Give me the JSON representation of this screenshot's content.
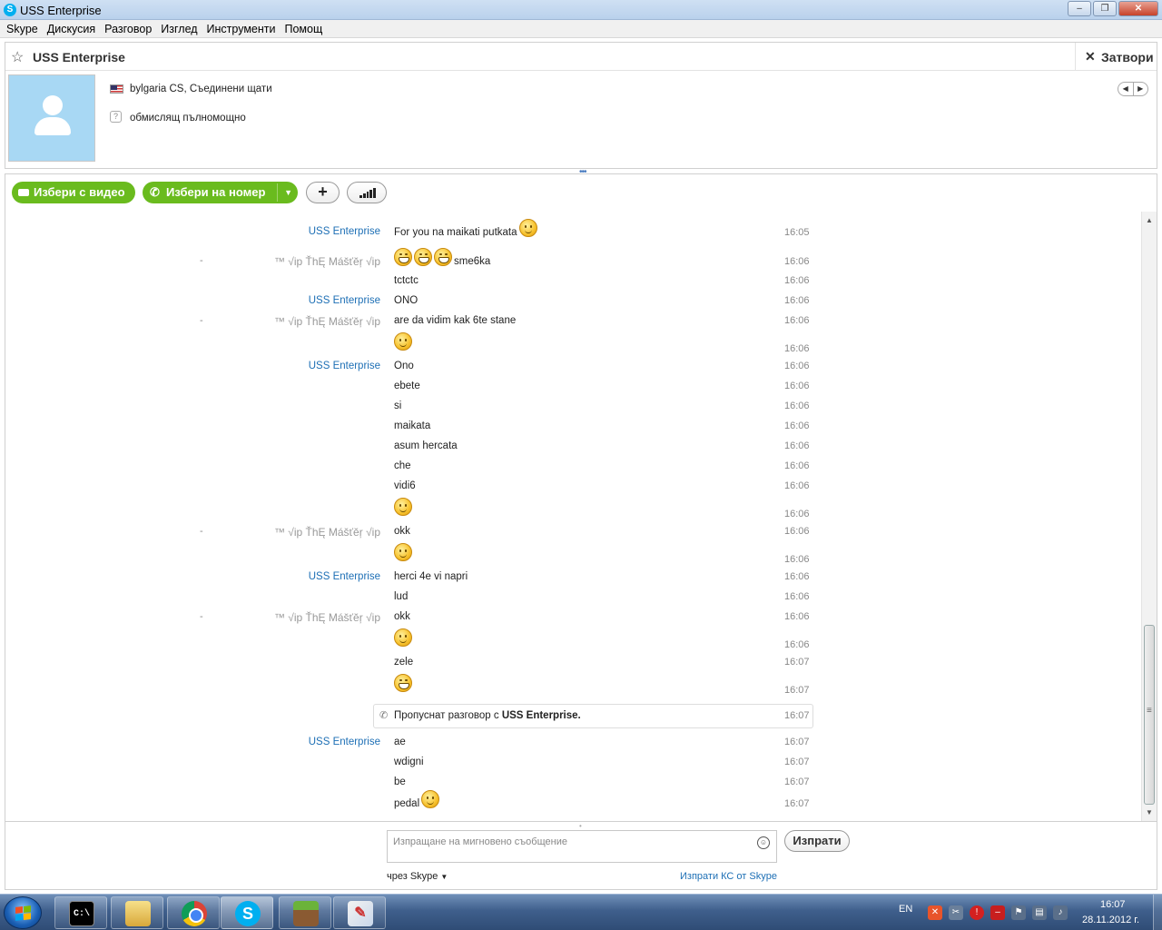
{
  "window": {
    "title": "USS Enterprise",
    "app_icon": "skype-icon"
  },
  "menu": [
    "Skype",
    "Дискусия",
    "Разговор",
    "Изглед",
    "Инструменти",
    "Помощ"
  ],
  "header": {
    "contact_name": "USS Enterprise",
    "close_label": "Затвори",
    "location": "bylgaria CS, Съединени щати",
    "mood": "обмислящ пълномощно"
  },
  "actions": {
    "video_label": "Избери с видео",
    "call_label": "Избери на номер"
  },
  "messages": [
    {
      "sender": "USS Enterprise",
      "who": "them",
      "text": "For you na maikati putkata",
      "emoticon": "smile",
      "time": "16:05"
    },
    {
      "sender": "™ √ip ŤhĘ Mášťĕŗ √ip",
      "who": "me",
      "text": "sme6ka",
      "emoticon_prefix": "laugh",
      "time": "16:06"
    },
    {
      "sender": "",
      "who": "me",
      "text": "tctctc",
      "time": "16:06"
    },
    {
      "sender": "USS Enterprise",
      "who": "them",
      "text": "ONO",
      "time": "16:06"
    },
    {
      "sender": "™ √ip ŤhĘ Mášťĕŗ √ip",
      "who": "me",
      "text": "are da vidim kak 6te stane",
      "time": "16:06"
    },
    {
      "sender": "",
      "who": "me",
      "text": "",
      "emoticon": "smile",
      "time": "16:06"
    },
    {
      "sender": "USS Enterprise",
      "who": "them",
      "text": "Ono",
      "time": "16:06"
    },
    {
      "sender": "",
      "who": "them",
      "text": "ebete",
      "time": "16:06"
    },
    {
      "sender": "",
      "who": "them",
      "text": "si",
      "time": "16:06"
    },
    {
      "sender": "",
      "who": "them",
      "text": "maikata",
      "time": "16:06"
    },
    {
      "sender": "",
      "who": "them",
      "text": "asum hercata",
      "time": "16:06"
    },
    {
      "sender": "",
      "who": "them",
      "text": "che",
      "time": "16:06"
    },
    {
      "sender": "",
      "who": "them",
      "text": "vidi6",
      "time": "16:06"
    },
    {
      "sender": "",
      "who": "them",
      "text": "",
      "emoticon": "smile",
      "time": "16:06"
    },
    {
      "sender": "™ √ip ŤhĘ Mášťĕŗ √ip",
      "who": "me",
      "text": "okk",
      "time": "16:06"
    },
    {
      "sender": "",
      "who": "me",
      "text": "",
      "emoticon": "smile",
      "time": "16:06"
    },
    {
      "sender": "USS Enterprise",
      "who": "them",
      "text": "herci 4e vi napri",
      "time": "16:06"
    },
    {
      "sender": "",
      "who": "them",
      "text": "lud",
      "time": "16:06"
    },
    {
      "sender": "™ √ip ŤhĘ Mášťĕŗ √ip",
      "who": "me",
      "text": "okk",
      "time": "16:06"
    },
    {
      "sender": "",
      "who": "me",
      "text": "",
      "emoticon": "smile",
      "time": "16:06"
    },
    {
      "sender": "",
      "who": "me",
      "text": "zele",
      "time": "16:07"
    },
    {
      "sender": "",
      "who": "me",
      "text": "",
      "emoticon": "laugh",
      "time": "16:07"
    },
    {
      "sender": "USS Enterprise",
      "who": "them",
      "text": "ae",
      "time": "16:07"
    },
    {
      "sender": "",
      "who": "them",
      "text": "wdigni",
      "time": "16:07"
    },
    {
      "sender": "",
      "who": "them",
      "text": "be",
      "time": "16:07"
    },
    {
      "sender": "",
      "who": "them",
      "text": "pedal",
      "emoticon": "smile",
      "time": "16:07"
    }
  ],
  "missed_call": {
    "prefix": "Пропуснат разговор с",
    "name": "USS Enterprise.",
    "time": "16:07"
  },
  "composer": {
    "placeholder": "Изпращане на мигновено съобщение",
    "send_label": "Изпрати",
    "via_label": "чрез Skype",
    "sms_label": "Изпрати КС от Skype"
  },
  "taskbar": {
    "apps": [
      "cmd",
      "folder",
      "chrome",
      "skype",
      "minecraft",
      "paint"
    ],
    "lang": "EN",
    "time": "16:07",
    "date": "28.11.2012 г."
  }
}
